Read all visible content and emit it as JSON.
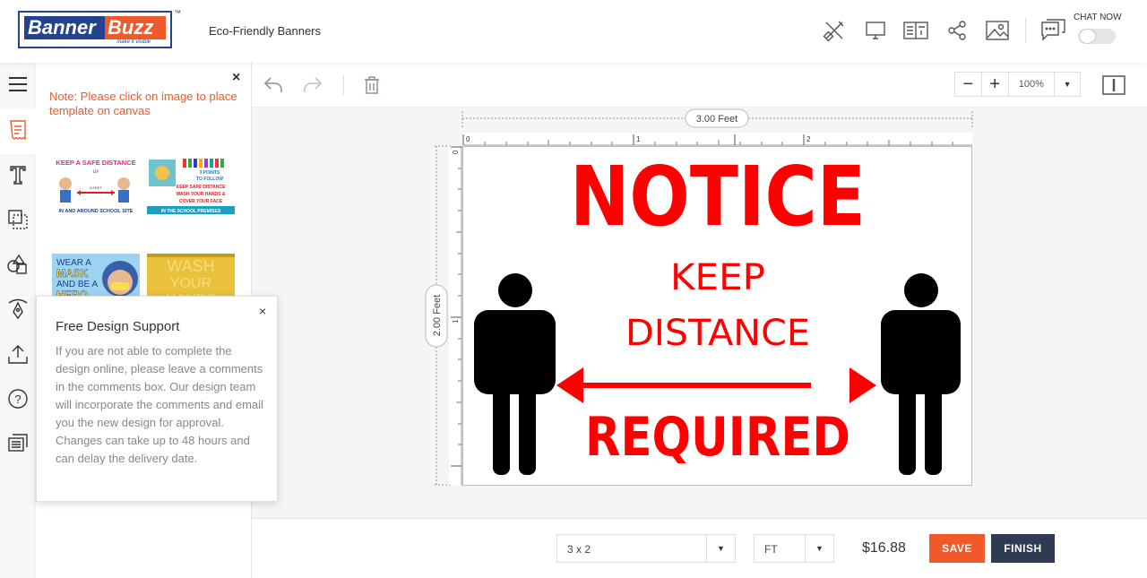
{
  "header": {
    "logo_part1": "Banner",
    "logo_part2": "Buzz",
    "logo_tagline": "make it visible",
    "logo_tm": "™",
    "page_title": "Eco-Friendly Banners",
    "chat_label": "CHAT NOW"
  },
  "panel": {
    "close": "×",
    "note": "Note: Please click on image to place template on canvas",
    "templates": [
      {
        "line1": "KEEP A SAFE DISTANCE",
        "line2": "OF",
        "line3": "6 FEET",
        "line4": "IN AND AROUND SCHOOL SITE"
      },
      {
        "line1": "3 POINTS",
        "line2": "TO FOLLOW",
        "line3": "KEEP SAFE DISTANCE",
        "line4": "WASH YOUR HANDS &",
        "line5": "COVER YOUR FACE",
        "line6": "IN THE SCHOOL PREMISES"
      },
      {
        "line1": "WEAR A",
        "line2": "MASK",
        "line3": "AND BE A",
        "line4": "HERO"
      },
      {
        "line1": "WASH",
        "line2": "YOUR",
        "line3": "HANDS"
      }
    ]
  },
  "popup": {
    "title": "Free Design Support",
    "close": "×",
    "body": "If you are not able to complete the design online, please leave a comments in the comments box. Our design team will incorporate the comments and email you the new design for approval. Changes can take up to 48 hours and can delay the delivery date."
  },
  "toolbar": {
    "zoom_minus": "−",
    "zoom_plus": "+",
    "zoom_value": "100%",
    "dropdown": "▼"
  },
  "canvas": {
    "width_label": "3.00 Feet",
    "height_label": "2.00 Feet",
    "ruler_h": [
      "0",
      "1",
      "2"
    ],
    "ruler_v": [
      "0",
      "1"
    ],
    "sign": {
      "notice": "NOTICE",
      "keep": "KEEP",
      "distance": "DISTANCE",
      "required": "REQUIRED"
    }
  },
  "footer": {
    "size": "3 x 2",
    "unit": "FT",
    "price": "$16.88",
    "save": "SAVE",
    "finish": "FINISH",
    "dropdown": "▼"
  },
  "colors": {
    "accent": "#ef5a2a",
    "brand_blue": "#23438f",
    "finish_bg": "#2f3b52",
    "sign_red": "#ff0000"
  }
}
